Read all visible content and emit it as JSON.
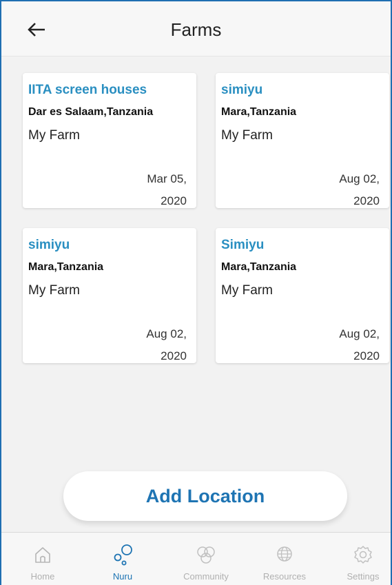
{
  "header": {
    "title": "Farms"
  },
  "farms": [
    {
      "name": "IITA screen houses",
      "location": "Dar es Salaam,Tanzania",
      "type": "My Farm",
      "date_line1": "Mar 05,",
      "date_line2": "2020"
    },
    {
      "name": "simiyu",
      "location": "Mara,Tanzania",
      "type": "My Farm",
      "date_line1": "Aug 02,",
      "date_line2": "2020"
    },
    {
      "name": "simiyu",
      "location": "Mara,Tanzania",
      "type": "My Farm",
      "date_line1": "Aug 02,",
      "date_line2": "2020"
    },
    {
      "name": "Simiyu",
      "location": "Mara,Tanzania",
      "type": "My Farm",
      "date_line1": "Aug 02,",
      "date_line2": "2020"
    }
  ],
  "add_button": {
    "label": "Add Location"
  },
  "tabs": [
    {
      "label": "Home",
      "icon": "home-icon"
    },
    {
      "label": "Nuru",
      "icon": "nuru-icon",
      "active": true
    },
    {
      "label": "Community",
      "icon": "community-icon"
    },
    {
      "label": "Resources",
      "icon": "globe-icon"
    },
    {
      "label": "Settings",
      "icon": "gear-icon"
    }
  ],
  "colors": {
    "accent": "#1e74b3",
    "farm_name": "#2a8fc1",
    "inactive_tab": "#b0b0b0"
  }
}
